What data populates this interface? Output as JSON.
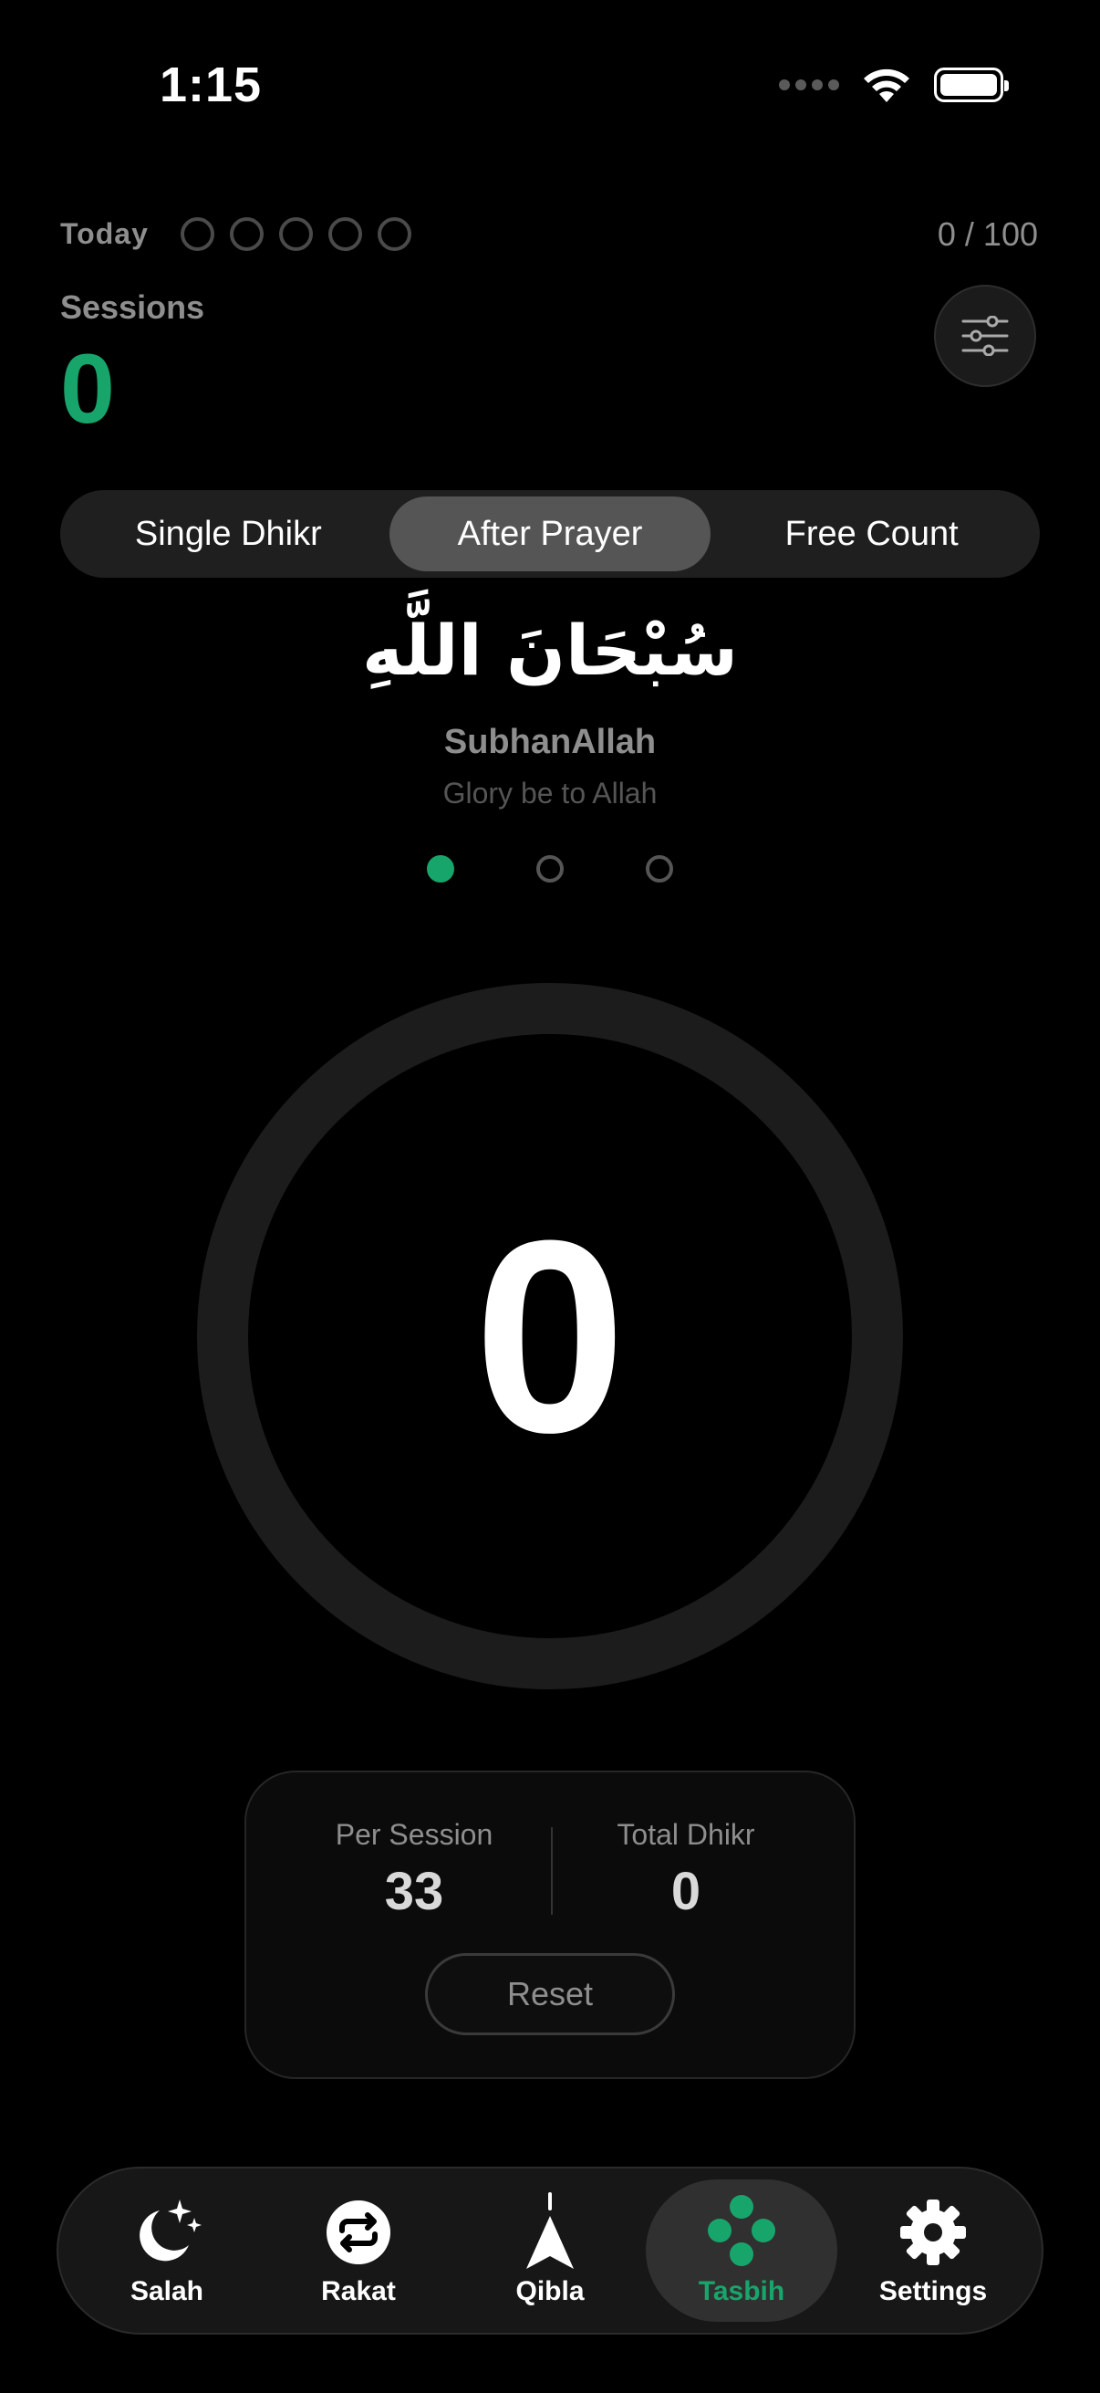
{
  "status_bar": {
    "time": "1:15"
  },
  "top": {
    "today_label": "Today",
    "today_dots_count": 5,
    "goal": "0 / 100",
    "sessions_label": "Sessions",
    "sessions_value": "0"
  },
  "mode_tabs": [
    {
      "label": "Single Dhikr",
      "active": false
    },
    {
      "label": "After Prayer",
      "active": true
    },
    {
      "label": "Free Count",
      "active": false
    }
  ],
  "dhikr": {
    "arabic": "سُبْحَانَ اللَّهِ",
    "transliteration": "SubhanAllah",
    "meaning": "Glory be to Allah",
    "pager_total": 3,
    "pager_active": 0
  },
  "counter": {
    "value": "0"
  },
  "stats": {
    "per_session_label": "Per Session",
    "per_session_value": "33",
    "total_label": "Total Dhikr",
    "total_value": "0",
    "reset_label": "Reset"
  },
  "tab_bar": {
    "items": [
      {
        "label": "Salah",
        "icon": "moon-stars-icon",
        "active": false
      },
      {
        "label": "Rakat",
        "icon": "repeat-icon",
        "active": false
      },
      {
        "label": "Qibla",
        "icon": "compass-arrow-icon",
        "active": false
      },
      {
        "label": "Tasbih",
        "icon": "tasbih-beads-icon",
        "active": true
      },
      {
        "label": "Settings",
        "icon": "gear-icon",
        "active": false
      }
    ]
  },
  "colors": {
    "accent": "#18a56b",
    "background": "#000000"
  }
}
